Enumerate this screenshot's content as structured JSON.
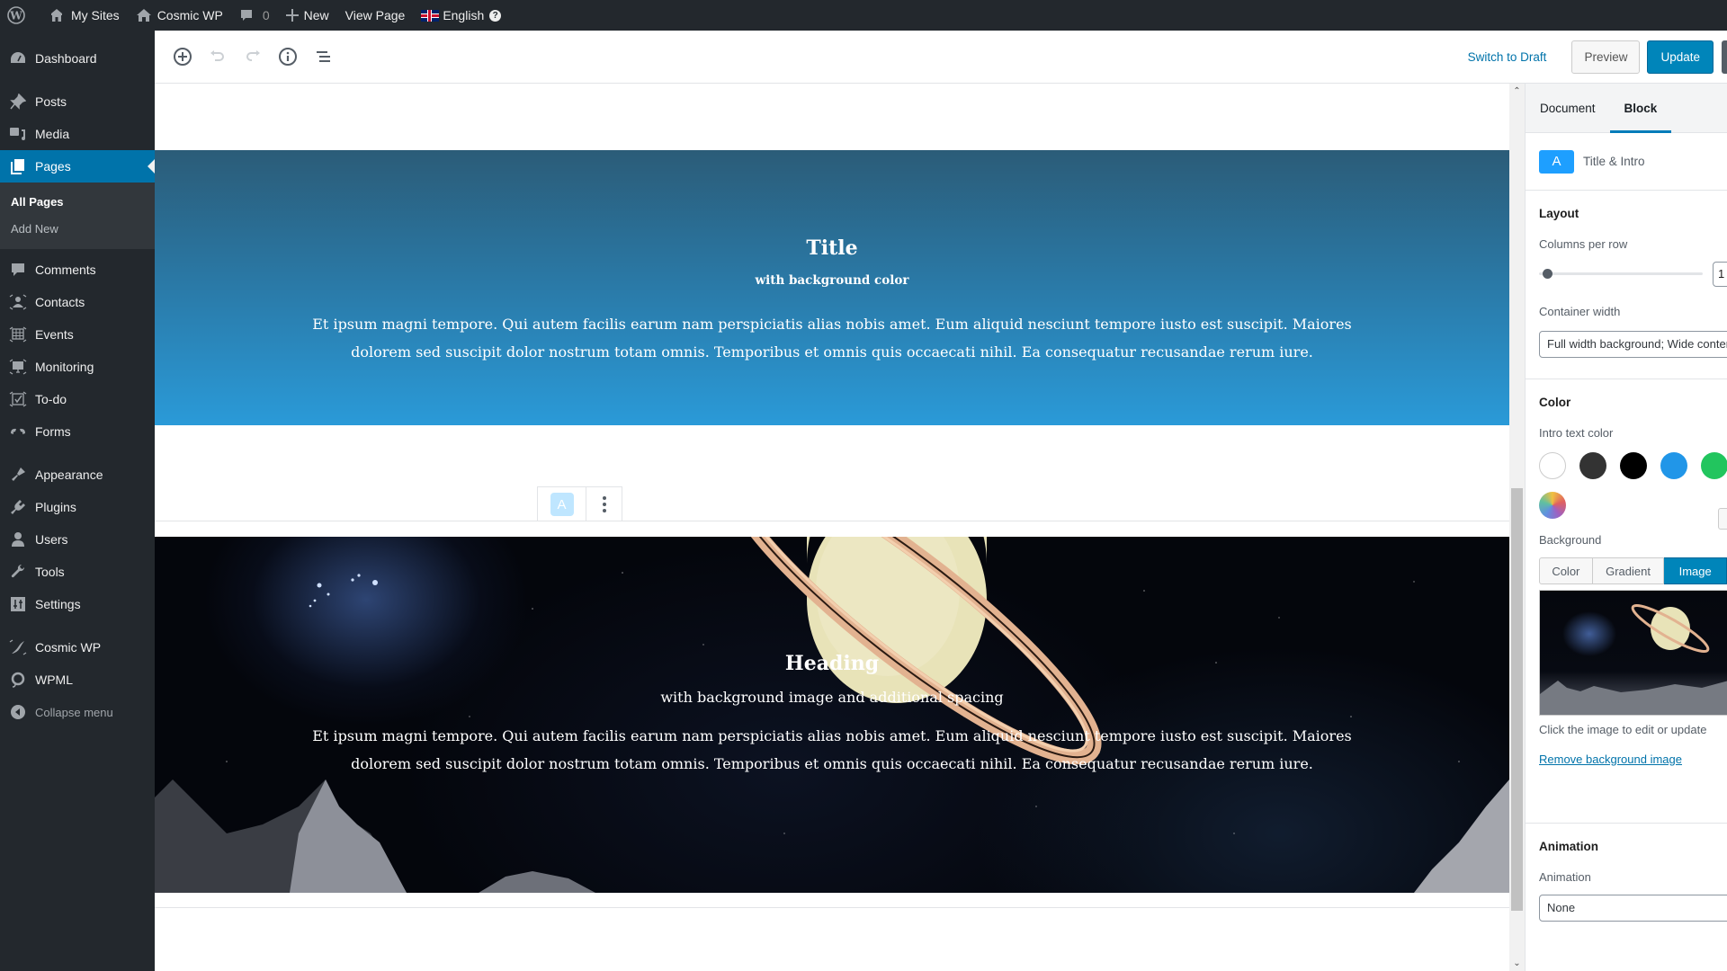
{
  "admin_bar": {
    "my_sites": "My Sites",
    "site_name": "Cosmic WP",
    "comments_count": "0",
    "new_label": "New",
    "view_page": "View Page",
    "language": "English"
  },
  "admin_menu": {
    "items": [
      {
        "label": "Dashboard",
        "icon": "dashboard-icon"
      },
      {
        "label": "Posts",
        "icon": "pin-icon"
      },
      {
        "label": "Media",
        "icon": "media-icon"
      },
      {
        "label": "Pages",
        "icon": "pages-icon",
        "current": true
      },
      {
        "label": "Comments",
        "icon": "comment-icon"
      },
      {
        "label": "Contacts",
        "icon": "contacts-icon"
      },
      {
        "label": "Events",
        "icon": "events-icon"
      },
      {
        "label": "Monitoring",
        "icon": "monitoring-icon"
      },
      {
        "label": "To-do",
        "icon": "todo-icon"
      },
      {
        "label": "Forms",
        "icon": "forms-icon"
      },
      {
        "label": "Appearance",
        "icon": "brush-icon"
      },
      {
        "label": "Plugins",
        "icon": "plug-icon"
      },
      {
        "label": "Users",
        "icon": "user-icon"
      },
      {
        "label": "Tools",
        "icon": "wrench-icon"
      },
      {
        "label": "Settings",
        "icon": "settings-icon"
      },
      {
        "label": "Cosmic WP",
        "icon": "cosmic-icon"
      },
      {
        "label": "WPML",
        "icon": "wpml-icon"
      }
    ],
    "pages_submenu": [
      "All Pages",
      "Add New"
    ],
    "collapse_label": "Collapse menu"
  },
  "editor_header": {
    "switch_to_draft": "Switch to Draft",
    "preview": "Preview",
    "update": "Update"
  },
  "canvas": {
    "title_block": {
      "title": "Title",
      "subtitle": "with background color",
      "intro": "Et ipsum magni tempore. Qui autem facilis earum nam perspiciatis alias nobis amet. Eum aliquid nesciunt tempore iusto est suscipit. Maiores dolorem sed suscipit dolor nostrum totam omnis. Temporibus et omnis quis occaecati nihil. Ea consequatur recusandae rerum iure."
    },
    "block_toolbar": {
      "block_icon_letter": "A"
    },
    "hero_block": {
      "title": "Heading",
      "subtitle": "with background image and additional spacing",
      "intro": "Et ipsum magni tempore. Qui autem facilis earum nam perspiciatis alias nobis amet. Eum aliquid nesciunt tempore iusto est suscipit. Maiores dolorem sed suscipit dolor nostrum totam omnis. Temporibus et omnis quis occaecati nihil. Ea consequatur recusandae rerum iure."
    }
  },
  "settings_sidebar": {
    "tabs": [
      "Document",
      "Block"
    ],
    "active_tab": "Block",
    "block_card": {
      "icon_letter": "A",
      "name": "Title & Intro"
    },
    "layout": {
      "title": "Layout",
      "columns_label": "Columns per row",
      "columns_value": "1",
      "container_label": "Container width",
      "container_value": "Full width background; Wide content"
    },
    "color": {
      "title": "Color",
      "intro_text_color_label": "Intro text color",
      "swatches": [
        "#ffffff",
        "#333333",
        "#000000",
        "#2196e8",
        "#22c55e"
      ],
      "background_label": "Background",
      "background_options": [
        "Color",
        "Gradient",
        "Image"
      ],
      "background_selected": "Image",
      "image_hint": "Click the image to edit or update",
      "remove_link": "Remove background image"
    },
    "animation": {
      "title": "Animation",
      "label": "Animation",
      "value": "None"
    }
  }
}
